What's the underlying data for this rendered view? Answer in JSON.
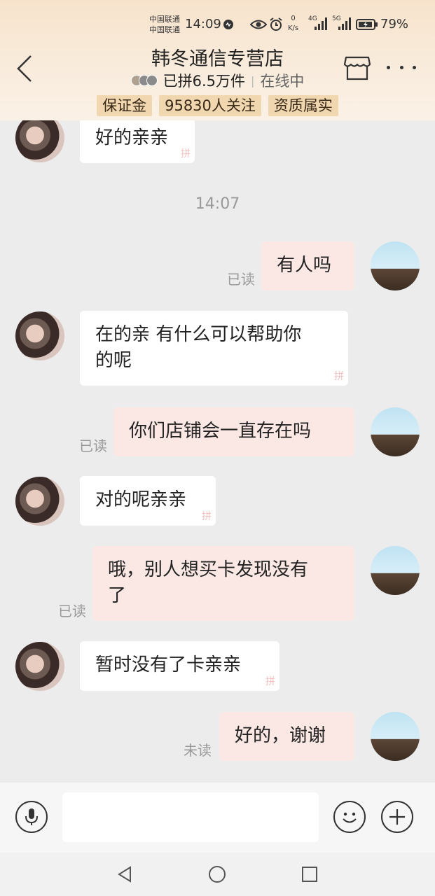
{
  "status_bar": {
    "carrier_1": "中国联通",
    "carrier_2": "中国联通",
    "time": "14:09",
    "net_speed_value": "0",
    "net_speed_unit": "K/s",
    "signal_1_label": "4G",
    "signal_2_label": "5G",
    "battery": "79%"
  },
  "header": {
    "shop_name": "韩冬通信专营店",
    "sold": "已拼6.5万件",
    "online": "在线中",
    "badges": [
      "保证金",
      "95830人关注",
      "资质属实"
    ],
    "icons": {
      "back": "chevron-left-icon",
      "store": "store-icon",
      "more": "more-icon"
    }
  },
  "messages": [
    {
      "from": "shop",
      "text": "好的亲亲"
    },
    {
      "type": "time",
      "text": "14:07"
    },
    {
      "from": "me",
      "text": "有人吗",
      "status": "已读"
    },
    {
      "from": "shop",
      "text_line1": "在的亲 有什么可以帮助你",
      "text_line2": "的呢"
    },
    {
      "from": "me",
      "text": "你们店铺会一直存在吗",
      "status": "已读"
    },
    {
      "from": "shop",
      "text": "对的呢亲亲"
    },
    {
      "from": "me",
      "text_line1": "哦，别人想买卡发现没有",
      "text_line2": "了",
      "status": "已读"
    },
    {
      "from": "shop",
      "text": "暂时没有了卡亲亲"
    },
    {
      "from": "me",
      "text": "好的，谢谢",
      "status": "未读"
    }
  ],
  "input_bar": {
    "placeholder": "",
    "icons": {
      "voice": "microphone-icon",
      "emoji": "emoji-icon",
      "plus": "plus-icon"
    }
  },
  "nav_bar": {
    "icons": [
      "back-triangle-icon",
      "home-circle-icon",
      "recents-square-icon"
    ]
  },
  "colors": {
    "header_bg": "#f7e3cc",
    "badge_bg": "#f0d7b0",
    "chat_bg": "#ececec",
    "incoming_bubble": "#ffffff",
    "outgoing_bubble": "#fbe8e4",
    "read_status": "#999999"
  }
}
